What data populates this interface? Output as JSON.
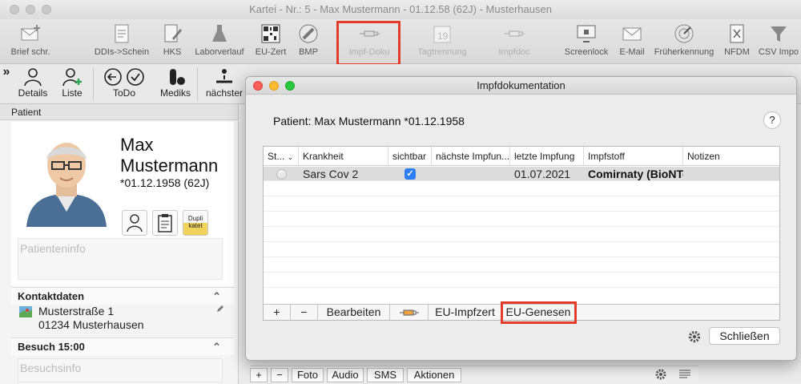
{
  "window": {
    "title": "Kartei - Nr.: 5 - Max Mustermann - 01.12.58 (62J) - Musterhausen"
  },
  "toolbar": [
    {
      "label": "Brief schr.",
      "icon": "letter-plus-icon"
    },
    {
      "label": "DDIs->Schein",
      "icon": "document-icon"
    },
    {
      "label": "HKS",
      "icon": "form-edit-icon"
    },
    {
      "label": "Laborverlauf",
      "icon": "flask-icon"
    },
    {
      "label": "EU-Zert",
      "icon": "qr-code-icon"
    },
    {
      "label": "BMP",
      "icon": "pill-icon"
    },
    {
      "label": "Impf-Doku",
      "icon": "syringe-icon"
    },
    {
      "label": "Tagtrennung",
      "icon": "calendar-icon"
    },
    {
      "label": "Impfdoc",
      "icon": "syringe-icon"
    },
    {
      "label": "Screenlock",
      "icon": "monitor-lock-icon"
    },
    {
      "label": "E-Mail",
      "icon": "mail-icon"
    },
    {
      "label": "Früherkennung",
      "icon": "radar-icon"
    },
    {
      "label": "NFDM",
      "icon": "medical-doc-icon"
    },
    {
      "label": "CSV Impo",
      "icon": "funnel-icon"
    }
  ],
  "toolbar2": [
    {
      "label": "Details",
      "icon": "person-icon"
    },
    {
      "label": "Liste",
      "icon": "person-add-icon"
    },
    {
      "label": "ToDo",
      "icon": "back-check-icon"
    },
    {
      "label": "Mediks",
      "icon": "pills-icon"
    },
    {
      "label": "nächster",
      "icon": "next-patient-icon"
    }
  ],
  "patient_panel": {
    "header": "Patient",
    "name_first": "Max",
    "name_last": "Mustermann",
    "dob": "*01.12.1958 (62J)",
    "dupli_label": "Dupli katet",
    "info_placeholder": "Patienteninfo",
    "contact_header": "Kontaktdaten",
    "street": "Musterstraße 1",
    "city": "01234 Musterhausen",
    "visit_header": "Besuch 15:00",
    "visit_placeholder": "Besuchsinfo"
  },
  "bottombar": {
    "plus": "+",
    "minus": "−",
    "foto": "Foto",
    "audio": "Audio",
    "sms": "SMS",
    "aktionen": "Aktionen"
  },
  "dialog": {
    "title": "Impfdokumentation",
    "patient_label": "Patient:",
    "patient_value": "Max Mustermann *01.12.1958",
    "help": "?",
    "columns": [
      "St...",
      "Krankheit",
      "sichtbar",
      "nächste Impfun...",
      "letzte Impfung",
      "Impfstoff",
      "Notizen"
    ],
    "rows": [
      {
        "krankheit": "Sars Cov 2",
        "sichtbar": true,
        "naechste": "",
        "letzte": "01.07.2021",
        "impfstoff": "Comirnaty (BioNTech)",
        "notizen": ""
      }
    ],
    "footer": {
      "add": "+",
      "remove": "−",
      "edit": "Bearbeiten",
      "eu_impfzert": "EU-Impfzert",
      "eu_genesen": "EU-Genesen"
    },
    "close_label": "Schließen"
  },
  "colors": {
    "highlight": "#e53b2b",
    "checkbox": "#2d7ff9"
  }
}
